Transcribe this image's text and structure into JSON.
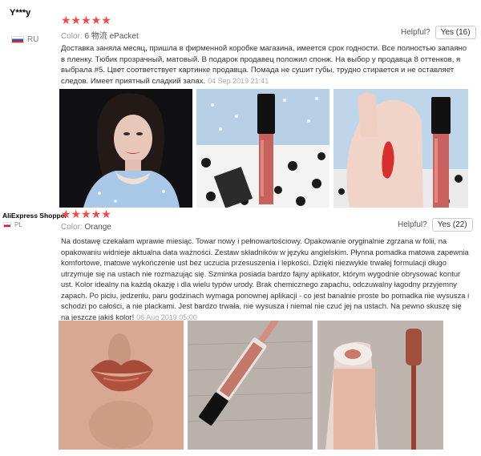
{
  "reviews": [
    {
      "user": "Y***y",
      "country": "RU",
      "stars": "★★★★★",
      "meta_label": "Color:",
      "meta_value": "6 物流 ePacket",
      "helpful_label": "Helpful?",
      "yes_label": "Yes (16)",
      "text": "Доставка заняла месяц, пришла в фирменной коробке магазина, имеется срок годности. Все полностью запаяно в пленку. Тюбик прозрачный, матовый. В подарок продавец положил спонж. На выбор у продавца 8 оттенков, я выбрала #5. Цвет соответствует картинке продавца. Помада не сушит губы, трудно стирается и не оставляет следов. Имеет приятный сладкий запах.",
      "date": "04 Sep 2019 21:41"
    },
    {
      "user": "AliExpress Shopper",
      "country": "PL",
      "stars": "★★★★★",
      "meta_label": "Color:",
      "meta_value": "Orange",
      "helpful_label": "Helpful?",
      "yes_label": "Yes (22)",
      "text": "Na dostawę czekałam wprawie miesiąc. Towar nowy i pełnowartościowy. Opakowanie oryginalnie zgrzana w folii, na opakowaniu widnieje aktualna data ważności. Zestaw składników w języku angielskim. Płynna pomadka matowa zapewnia komfortowe, matowe wykończenie ust bez uczucia przesuszenia i lepkości. Dzięki niezwykle trwałej formulacji długo utrzymuje się na ustach nie rozmazując się. Szminka posiada bardzo fajny aplikator, którym wygodnie obrysować kontur ust. Kolor idealny na każdą okazję i dla wielu typów urody. Brak chemicznego zapachu, odczuwalny łagodny przyjemny zapach. Po piciu, jedzeniu, paru godzinach wymaga ponownej aplikacji - co jest banalnie proste bo pomadka nie wysusza i schodzi po całości, a nie plackami. Jest bardzo trwała, nie wysusza i niemal nie czuć jej na ustach. Na pewno skuszę się na jeszcze jakiś kolor!",
      "date": "06 Aug 2019 05:00"
    }
  ],
  "icons": [
    "flag-ru-icon",
    "flag-pl-icon"
  ],
  "colors": {
    "star": "#ff4747",
    "text": "#333333",
    "muted": "#999999"
  }
}
